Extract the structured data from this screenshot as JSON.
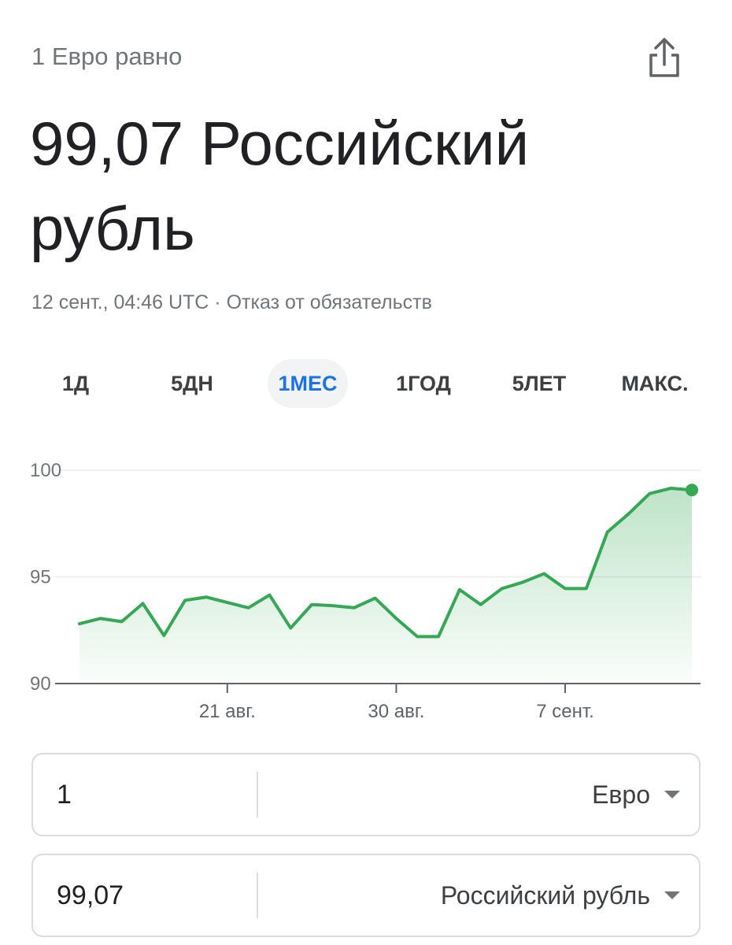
{
  "header": {
    "subtitle": "1 Евро равно",
    "headline": "99,07 Российский рубль",
    "meta": "12 сент., 04:46 UTC · Отказ от обязательств"
  },
  "icons": {
    "share": "share-icon",
    "dropdown": "caret-down-icon"
  },
  "tabs": [
    {
      "label": "1Д",
      "active": false
    },
    {
      "label": "5ДН",
      "active": false
    },
    {
      "label": "1МЕС",
      "active": true
    },
    {
      "label": "1ГОД",
      "active": false
    },
    {
      "label": "5ЛЕТ",
      "active": false
    },
    {
      "label": "МАКС.",
      "active": false
    }
  ],
  "chart_data": {
    "type": "area",
    "title": "",
    "xlabel": "",
    "ylabel": "",
    "ylim": [
      90,
      100
    ],
    "yticks": [
      "90",
      "95",
      "100"
    ],
    "xticks": [
      "21 авг.",
      "30 авг.",
      "7 сент."
    ],
    "grid": true,
    "series": [
      {
        "values": [
          92.8,
          93.05,
          92.9,
          93.75,
          92.25,
          93.9,
          94.05,
          93.8,
          93.55,
          94.15,
          92.6,
          93.7,
          93.65,
          93.55,
          94.0,
          93.05,
          92.2,
          92.2,
          94.4,
          93.7,
          94.45,
          94.75,
          95.15,
          94.45,
          94.45,
          97.1,
          97.95,
          98.9,
          99.15,
          99.07
        ],
        "color": "#34a853"
      }
    ],
    "last_value": 99.07
  },
  "converter": {
    "from": {
      "amount": "1",
      "currency": "Евро"
    },
    "to": {
      "amount": "99,07",
      "currency": "Российский рубль"
    }
  }
}
